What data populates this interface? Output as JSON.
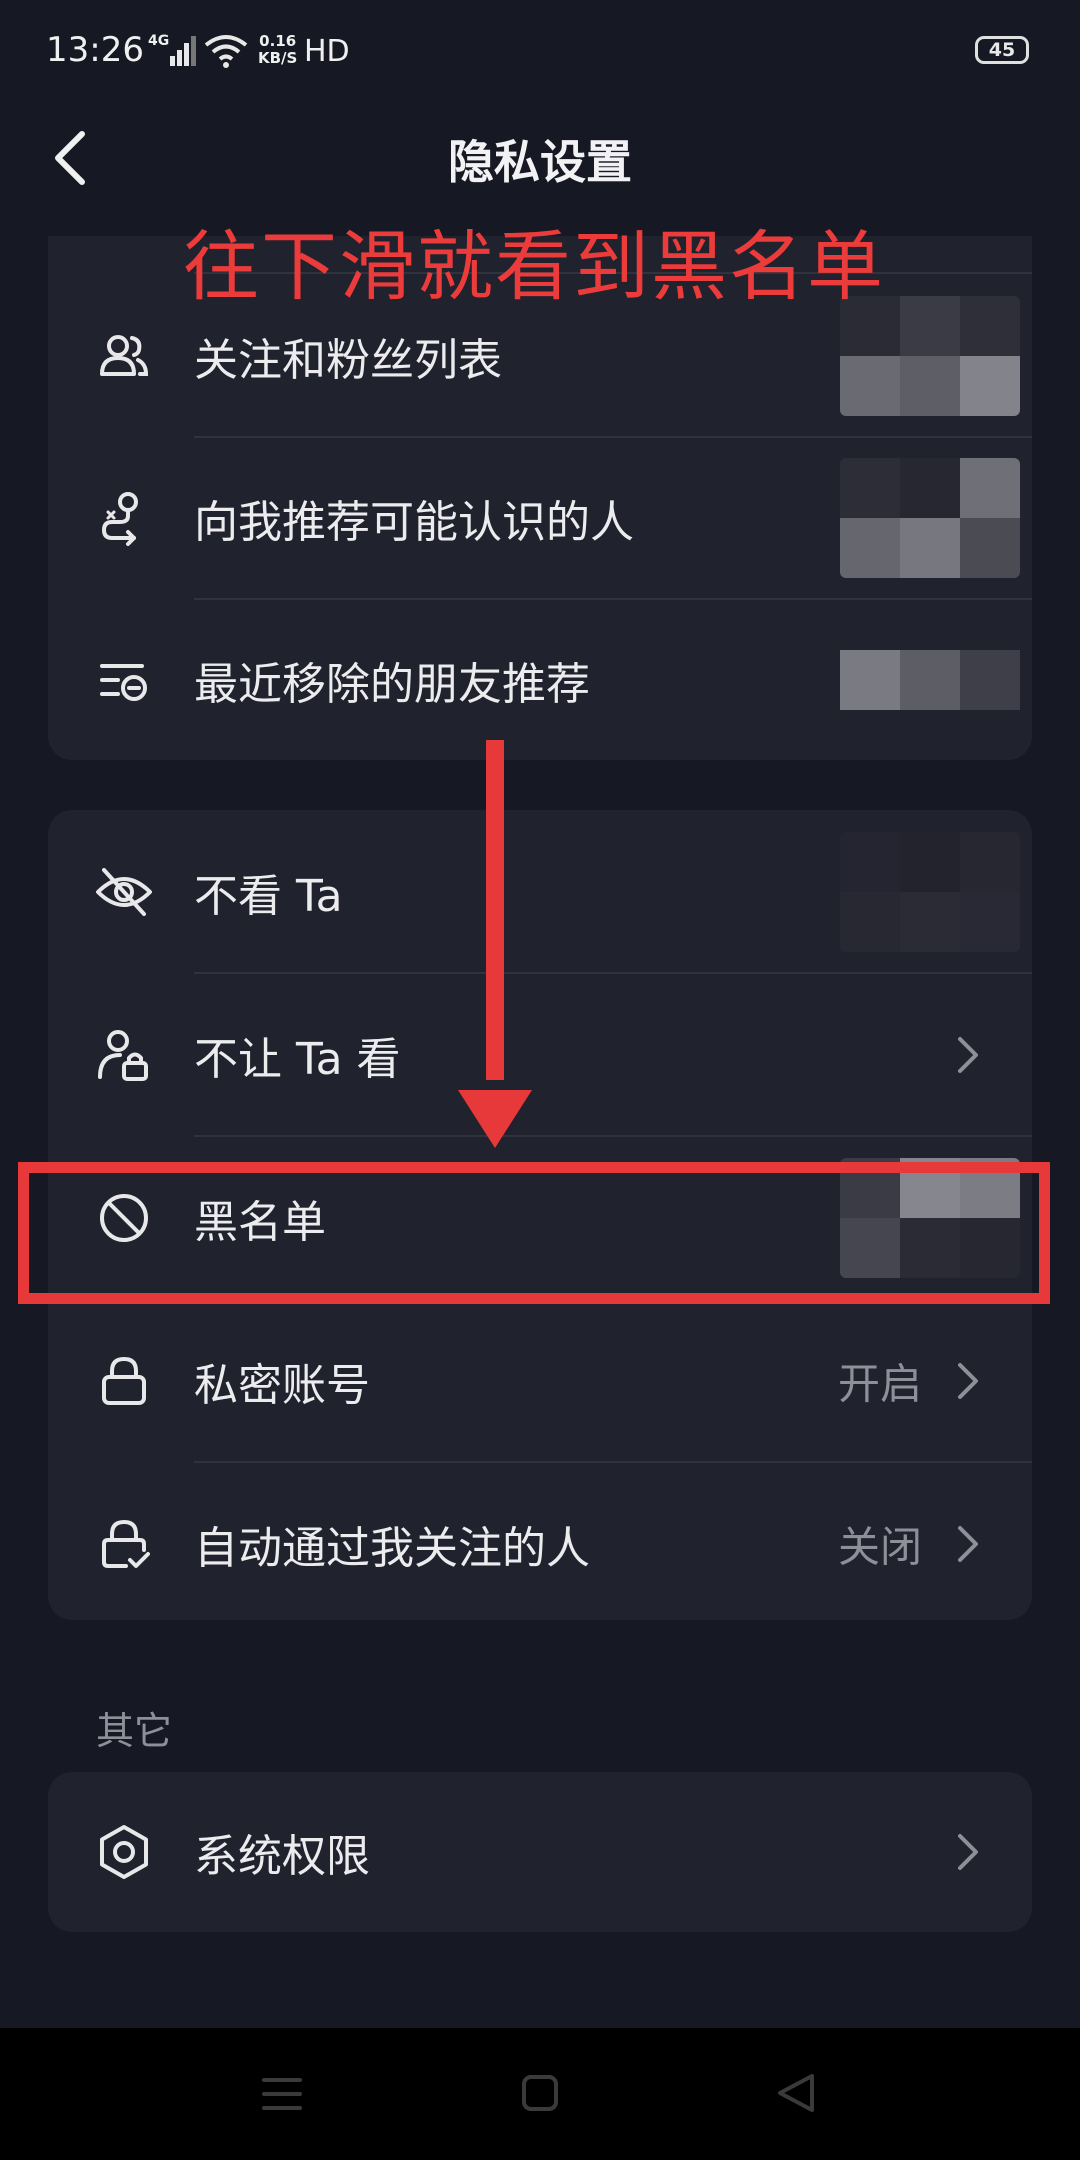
{
  "status_bar": {
    "time": "13:26",
    "network": "4G",
    "speed_value": "0.16",
    "speed_unit": "KB/S",
    "hd": "HD",
    "battery": "45"
  },
  "header": {
    "title": "隐私设置"
  },
  "annotation": {
    "text": "往下滑就看到黑名单"
  },
  "group1": {
    "items": [
      {
        "label": "关注和粉丝列表",
        "icon": "people-icon"
      },
      {
        "label": "向我推荐可能认识的人",
        "icon": "person-route-icon"
      },
      {
        "label": "最近移除的朋友推荐",
        "icon": "list-remove-icon"
      }
    ]
  },
  "group2": {
    "items": [
      {
        "label": "不看 Ta",
        "icon": "eye-off-icon"
      },
      {
        "label": "不让 Ta 看",
        "icon": "person-lock-icon"
      },
      {
        "label": "黑名单",
        "icon": "block-icon"
      },
      {
        "label": "私密账号",
        "value": "开启",
        "icon": "lock-icon"
      },
      {
        "label": "自动通过我关注的人",
        "value": "关闭",
        "icon": "lock-check-icon"
      }
    ]
  },
  "section_other": {
    "title": "其它",
    "items": [
      {
        "label": "系统权限",
        "icon": "settings-hexagon-icon"
      }
    ]
  },
  "colors": {
    "background": "#161823",
    "card": "#20222d",
    "annotation": "#e8393a"
  }
}
